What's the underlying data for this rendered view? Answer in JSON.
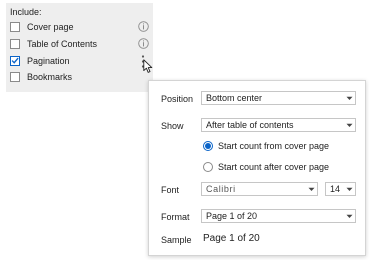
{
  "include": {
    "title": "Include:",
    "options": [
      {
        "label": "Cover page",
        "checked": false,
        "has_info": true
      },
      {
        "label": "Table of Contents",
        "checked": false,
        "has_info": true
      },
      {
        "label": "Pagination",
        "checked": true,
        "has_more": true
      },
      {
        "label": "Bookmarks",
        "checked": false
      }
    ]
  },
  "popup": {
    "position": {
      "label": "Position",
      "value": "Bottom center"
    },
    "show": {
      "label": "Show",
      "value": "After table of contents",
      "radios": [
        {
          "label": "Start count from cover page",
          "selected": true
        },
        {
          "label": "Start count after cover page",
          "selected": false
        }
      ]
    },
    "font": {
      "label": "Font",
      "value": "Calibri",
      "size": "14"
    },
    "format": {
      "label": "Format",
      "value": "Page 1 of 20"
    },
    "sample": {
      "label": "Sample",
      "value": "Page 1 of 20"
    }
  },
  "colors": {
    "accent": "#0b64c8",
    "panel_bg": "#eeeeee"
  }
}
